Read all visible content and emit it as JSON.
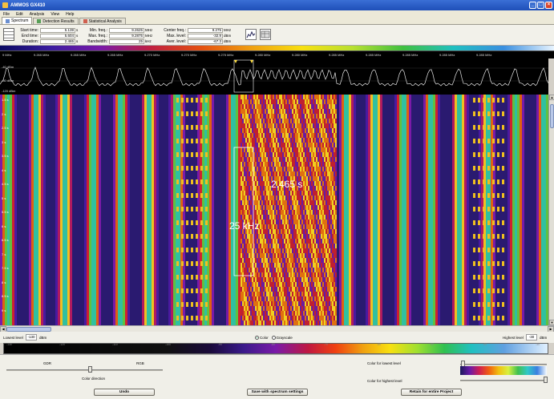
{
  "window": {
    "title": "AMMOS GX410"
  },
  "menu": [
    "File",
    "Edit",
    "Analysis",
    "View",
    "Help"
  ],
  "tabs": [
    {
      "label": "Spectrum",
      "active": true
    },
    {
      "label": "Detection Results",
      "active": false
    },
    {
      "label": "Statistical Analysis",
      "active": false
    }
  ],
  "params": {
    "col1": [
      {
        "label": "Start time:",
        "value": "5.139",
        "unit": "s"
      },
      {
        "label": "End time:",
        "value": "5.604",
        "unit": "s"
      },
      {
        "label": "Duration:",
        "value": "2.465",
        "unit": "s"
      }
    ],
    "col2": [
      {
        "label": "Min. freq.:",
        "value": "9.2625",
        "unit": "MHz"
      },
      {
        "label": "Max. freq.:",
        "value": "9.2875",
        "unit": "MHz"
      },
      {
        "label": "Bandwidth:",
        "value": "25",
        "unit": "kHz"
      }
    ],
    "col3": [
      {
        "label": "Center freq.:",
        "value": "9.275",
        "unit": "MHz"
      },
      {
        "label": "Max. level:",
        "value": "-32.9",
        "unit": "dBm"
      },
      {
        "label": "Aver. level:",
        "value": "-67.3",
        "unit": "dBm"
      }
    ]
  },
  "freq_axis": [
    "9 MHz",
    "9.265 MHz",
    "9.265 MHz",
    "9.265 MHz",
    "9.270 MHz",
    "9.270 MHz",
    "9.275 MHz",
    "9.280 MHz",
    "9.280 MHz",
    "9.285 MHz",
    "9.285 MHz",
    "9.285 MHz",
    "9.285 MHz",
    "9.285 MHz"
  ],
  "spectrum_labels": {
    "top": "-40 dBm",
    "mid": "-80 dBm",
    "bottom": "-120 dBm"
  },
  "time_ticks": [
    "1.5 s",
    "2 s",
    "2.5 s",
    "3 s",
    "3.5 s",
    "4 s",
    "4.5 s",
    "5 s",
    "5.5 s",
    "6 s",
    "6.5 s",
    "7 s",
    "7.5 s",
    "8 s",
    "8.5 s",
    "9 s"
  ],
  "annotations": {
    "duration": "2.465 s",
    "bandwidth": "25 kHz"
  },
  "level": {
    "lowest_label": "Lowest level",
    "lowest_value": "-130",
    "lowest_unit": "dBm",
    "highest_label": "Highest level",
    "highest_value": "-30",
    "highest_unit": "dBm",
    "color_option": "Color",
    "grayscale_option": "Grayscale"
  },
  "ramp_ticks": [
    "-130",
    "-120",
    "-110",
    "-100",
    "-90",
    "-80",
    "-70",
    "-60",
    "-50",
    "-40",
    "-30"
  ],
  "controls": {
    "gdr_label": "GDR",
    "rgb_label": "RGB",
    "color_direction_label": "Color direction",
    "lowest_color_label": "Color for lowest level",
    "highest_color_label": "Color for highest level",
    "undo_button": "Undo",
    "save_button": "Save with spectrum settings",
    "retain_button": "Retain for entire Project"
  },
  "colors": {
    "titlebar": "#2454c0",
    "waterfall_background": "#2a1a70",
    "signal_green": "#40c050",
    "signal_yellow": "#f0d020",
    "signal_red": "#d02030"
  }
}
